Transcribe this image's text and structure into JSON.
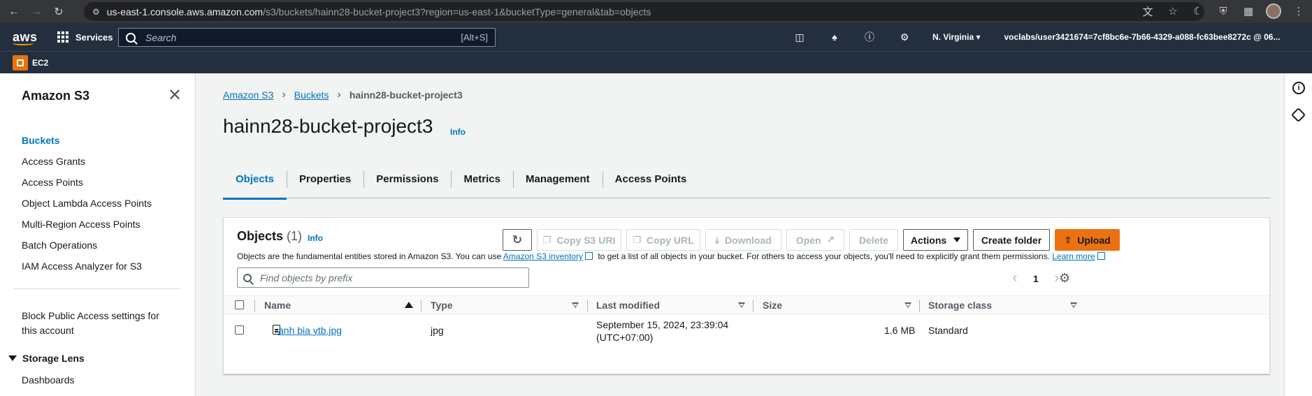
{
  "browser": {
    "url_host": "us-east-1.console.aws.amazon.com",
    "url_path": "/s3/buckets/hainn28-bucket-project3?region=us-east-1&bucketType=general&tab=objects"
  },
  "topnav": {
    "logo": "aws",
    "services": "Services",
    "search_placeholder": "Search",
    "search_shortcut": "[Alt+S]",
    "region": "N. Virginia",
    "account": "voclabs/user3421674=7cf8bc6e-7b66-4329-a088-fc63bee8272c @ 06..."
  },
  "favorites": {
    "ec2": "EC2"
  },
  "sidebar": {
    "title": "Amazon S3",
    "items": [
      {
        "label": "Buckets"
      },
      {
        "label": "Access Grants"
      },
      {
        "label": "Access Points"
      },
      {
        "label": "Object Lambda Access Points"
      },
      {
        "label": "Multi-Region Access Points"
      },
      {
        "label": "Batch Operations"
      },
      {
        "label": "IAM Access Analyzer for S3"
      }
    ],
    "block_public_access": "Block Public Access settings for this account",
    "storage_lens": "Storage Lens",
    "dashboards": "Dashboards"
  },
  "breadcrumb": {
    "root": "Amazon S3",
    "buckets": "Buckets",
    "current": "hainn28-bucket-project3"
  },
  "page": {
    "title": "hainn28-bucket-project3",
    "info": "Info"
  },
  "tabs": [
    {
      "label": "Objects"
    },
    {
      "label": "Properties"
    },
    {
      "label": "Permissions"
    },
    {
      "label": "Metrics"
    },
    {
      "label": "Management"
    },
    {
      "label": "Access Points"
    }
  ],
  "objects": {
    "heading": "Objects",
    "count": "(1)",
    "info": "Info",
    "desc_before": "Objects are the fundamental entities stored in Amazon S3. You can use ",
    "desc_link1": "Amazon S3 inventory",
    "desc_middle": " to get a list of all objects in your bucket. For others to access your objects, you'll need to explicitly grant them permissions. ",
    "desc_link2": "Learn more",
    "buttons": {
      "copy_s3_uri": "Copy S3 URI",
      "copy_url": "Copy URL",
      "download": "Download",
      "open": "Open",
      "delete": "Delete",
      "actions": "Actions",
      "create_folder": "Create folder",
      "upload": "Upload"
    },
    "filter_placeholder": "Find objects by prefix",
    "page": "1",
    "columns": {
      "name": "Name",
      "type": "Type",
      "last_modified": "Last modified",
      "size": "Size",
      "storage_class": "Storage class"
    },
    "rows": [
      {
        "name": "anh bia ytb.jpg",
        "type": "jpg",
        "last_modified_1": "September 15, 2024, 23:39:04",
        "last_modified_2": "(UTC+07:00)",
        "size": "1.6 MB",
        "storage_class": "Standard"
      }
    ]
  },
  "colors": {
    "aws_nav": "#232f3e",
    "link": "#0073bb",
    "upload": "#ec7211",
    "ec2": "#e8730c"
  }
}
